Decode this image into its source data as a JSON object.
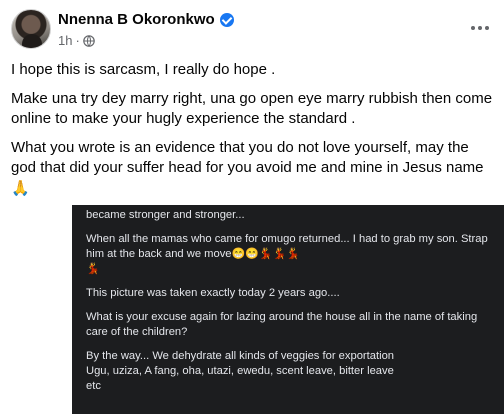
{
  "post": {
    "author_name": "Nnenna B Okoronkwo",
    "timestamp": "1h",
    "separator": "·",
    "paragraphs": [
      "I hope this is sarcasm,  I really do hope .",
      "Make una try dey marry right,  una go open eye marry rubbish then come online to make your hugly experience the standard .",
      "What you wrote is an evidence that you do not love yourself,  may the god that did your suffer head for you avoid me and mine in Jesus name"
    ],
    "end_emoji": "🙏"
  },
  "icons": {
    "verified": "verified-badge-icon",
    "privacy": "globe-icon",
    "more": "more-options-icon"
  },
  "colors": {
    "verified_blue": "#1877f2",
    "meta_gray": "#65676b",
    "dark_panel_bg": "#1c1d1f",
    "dark_panel_text": "#e4e6eb"
  },
  "shared_screenshot": {
    "lines": [
      "became stronger and stronger...",
      "When all the mamas who came for omugo returned... I had to grab my son. Strap him at the back and we move",
      "This picture was taken exactly today 2 years ago....",
      "What is your excuse again for lazing around the house all in the name of taking care of the children?",
      "By the way... We dehydrate all kinds of veggies for exportation\nUgu, uziza, A fang, oha, utazi, ewedu, scent leave, bitter leave\netc"
    ],
    "move_emojis": [
      "😁",
      "😁",
      "💃",
      "💃",
      "💃",
      "💃"
    ]
  }
}
